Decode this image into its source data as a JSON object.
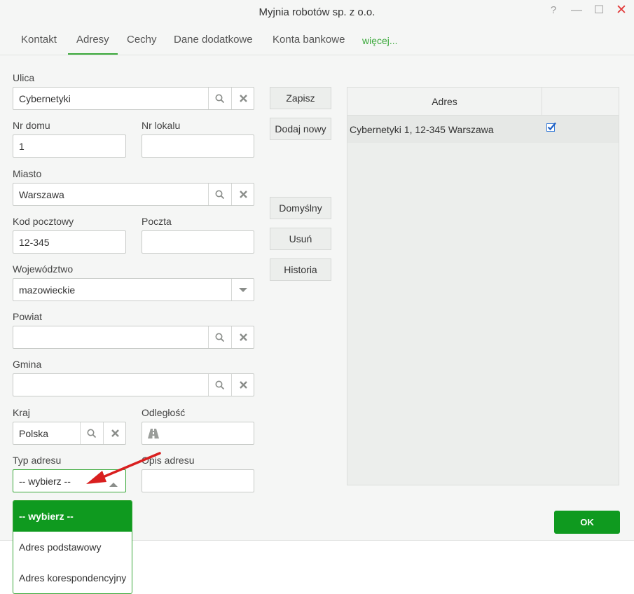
{
  "window": {
    "title": "Myjnia robotów sp. z o.o.",
    "controls": {
      "help": "?",
      "minimize": "—",
      "maximize": "☐",
      "close": "✕"
    }
  },
  "tabs": [
    {
      "label": "Kontakt"
    },
    {
      "label": "Adresy",
      "active": true
    },
    {
      "label": "Cechy"
    },
    {
      "label": "Dane dodatkowe"
    },
    {
      "label": "Konta bankowe"
    },
    {
      "label": "więcej..."
    }
  ],
  "form": {
    "ulica": {
      "label": "Ulica",
      "value": "Cybernetyki"
    },
    "nr_domu": {
      "label": "Nr domu",
      "value": "1"
    },
    "nr_lokalu": {
      "label": "Nr lokalu",
      "value": ""
    },
    "miasto": {
      "label": "Miasto",
      "value": "Warszawa"
    },
    "kod_pocztowy": {
      "label": "Kod pocztowy",
      "value": "12-345"
    },
    "poczta": {
      "label": "Poczta",
      "value": ""
    },
    "wojewodztwo": {
      "label": "Województwo",
      "value": "mazowieckie"
    },
    "powiat": {
      "label": "Powiat",
      "value": ""
    },
    "gmina": {
      "label": "Gmina",
      "value": ""
    },
    "kraj": {
      "label": "Kraj",
      "value": "Polska"
    },
    "odleglosc": {
      "label": "Odległość",
      "value": ""
    },
    "typ_adresu": {
      "label": "Typ adresu",
      "value": "-- wybierz --"
    },
    "opis_adresu": {
      "label": "Opis adresu",
      "value": ""
    }
  },
  "actions": {
    "zapisz": "Zapisz",
    "dodaj_nowy": "Dodaj nowy",
    "domyslny": "Domyślny",
    "usun": "Usuń",
    "historia": "Historia"
  },
  "grid": {
    "column_header": "Adres",
    "rows": [
      {
        "address": "Cybernetyki 1, 12-345 Warszawa",
        "default_checked": true
      }
    ]
  },
  "ok_label": "OK",
  "dropdown": {
    "options": [
      {
        "label": "-- wybierz --",
        "selected": true
      },
      {
        "label": "Adres podstawowy"
      },
      {
        "label": "Adres korespondencyjny"
      }
    ]
  },
  "colors": {
    "accent_green": "#0f9a1f",
    "tab_underline": "#3aa83a",
    "arrow_red": "#d91f1f",
    "close_red": "#e23b3b"
  },
  "icons": [
    "search-icon",
    "clear-icon",
    "chevron-down-icon",
    "chevron-up-icon",
    "road-icon",
    "checkbox-checked-icon"
  ]
}
